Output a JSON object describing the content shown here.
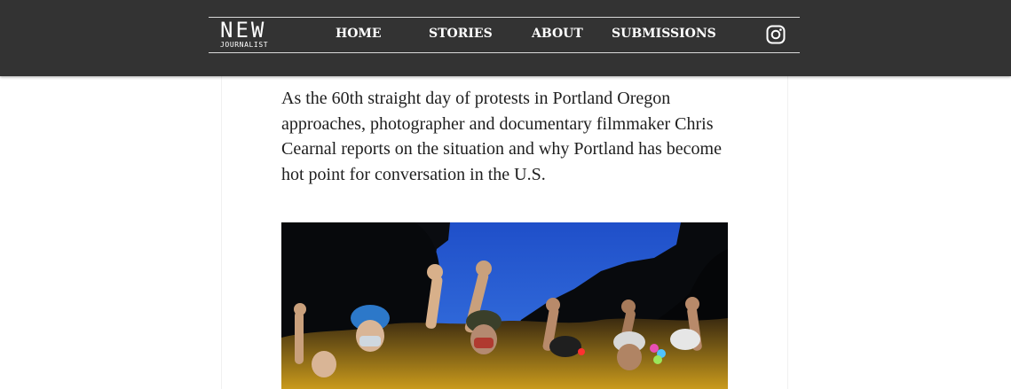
{
  "brand": {
    "logo_main": "NEW",
    "logo_sub": "JOURNALIST"
  },
  "nav": {
    "items": [
      {
        "label": "HOME"
      },
      {
        "label": "STORIES"
      },
      {
        "label": "ABOUT"
      },
      {
        "label": "SUBMISSIONS"
      }
    ],
    "social_icon": "instagram-icon"
  },
  "article": {
    "intro": "As the 60th straight day of protests in Portland Oregon approaches, photographer and documentary filmmaker Chris Cearnal reports on the situation and why Portland has become hot point for conversation in the U.S."
  },
  "colors": {
    "header_bg": "#333333",
    "header_text": "#ffffff",
    "body_text": "#1e1e1e",
    "page_bg": "#ffffff"
  }
}
